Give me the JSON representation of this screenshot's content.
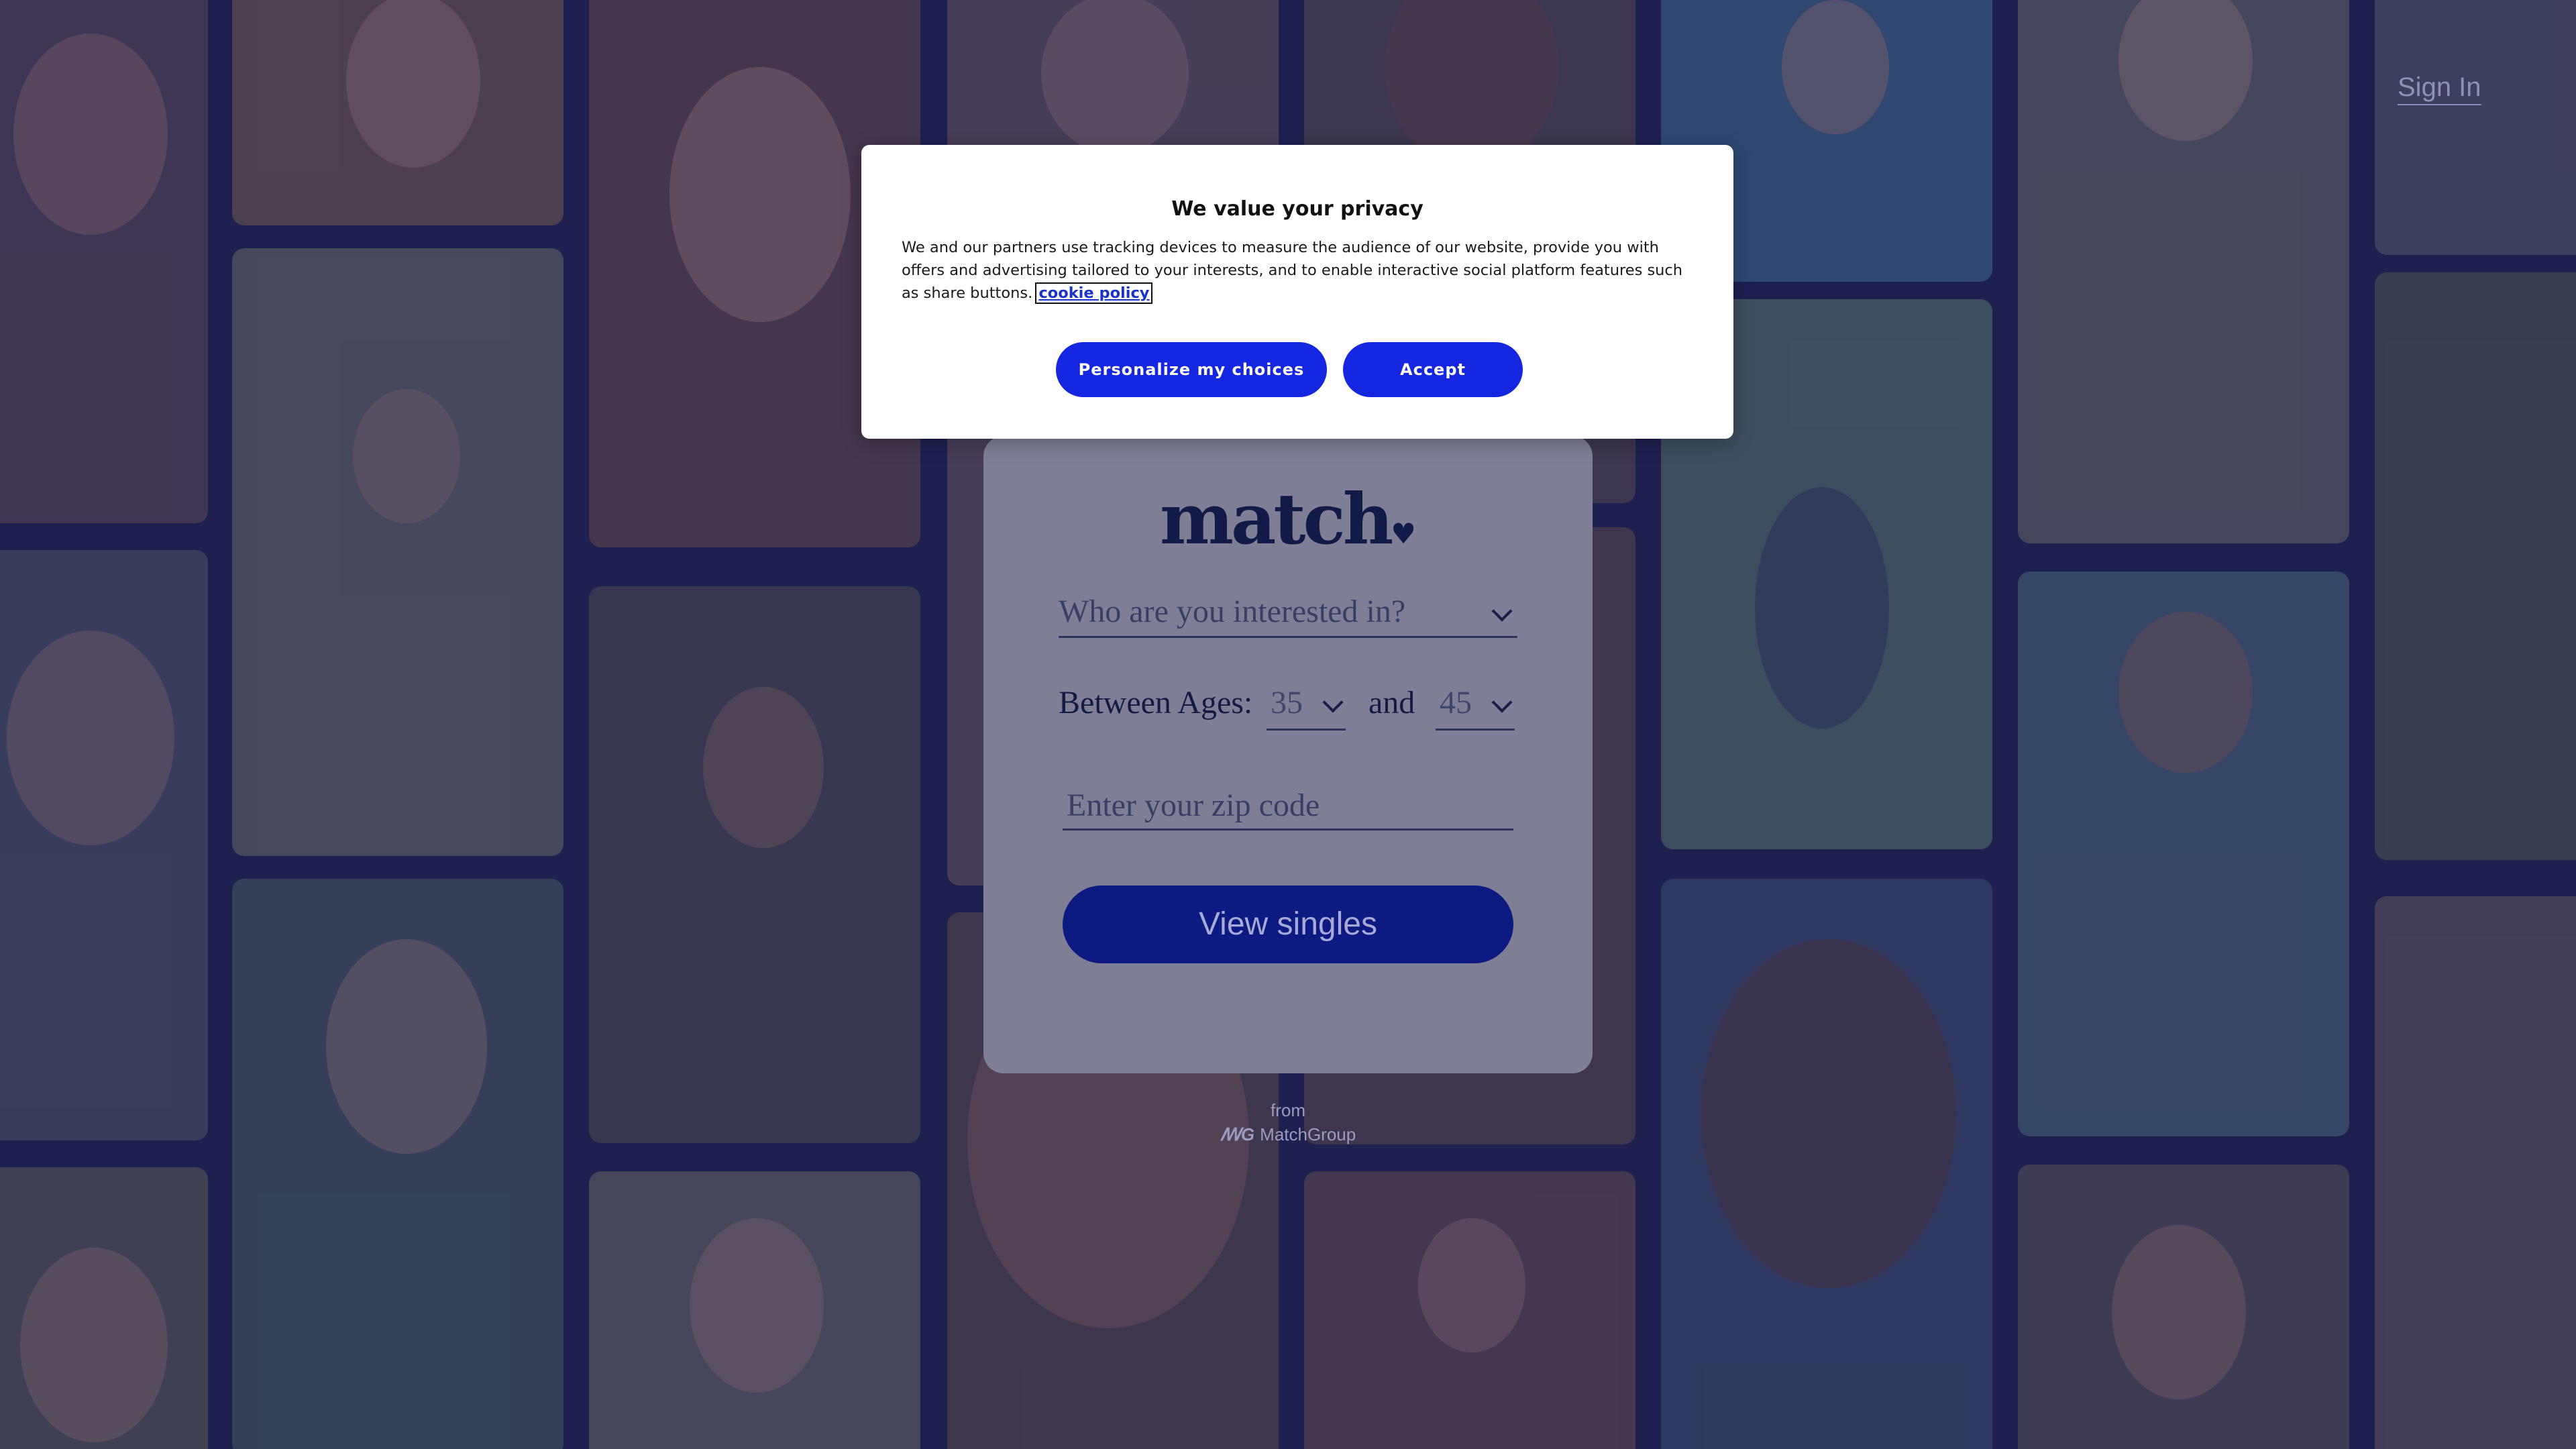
{
  "header": {
    "signin_label": "Sign In"
  },
  "privacy_modal": {
    "title": "We value your privacy",
    "body": "We and our partners use tracking devices to measure the audience of our website, provide you with offers and advertising tailored to your interests, and to enable interactive social platform features such as share buttons.",
    "link_label": "cookie policy",
    "personalize_label": "Personalize my choices",
    "accept_label": "Accept"
  },
  "search_card": {
    "logo_text": "match",
    "interest_placeholder": "Who are you interested in?",
    "ages_label": "Between Ages:",
    "age_min": "35",
    "and_label": "and",
    "age_max": "45",
    "zip_placeholder": "Enter your zip code",
    "submit_label": "View singles"
  },
  "footer": {
    "from_label": "from",
    "brand": "MatchGroup"
  },
  "colors": {
    "accent": "#1426e0",
    "button_dark": "#0d1a82",
    "overlay": "#14164a"
  }
}
